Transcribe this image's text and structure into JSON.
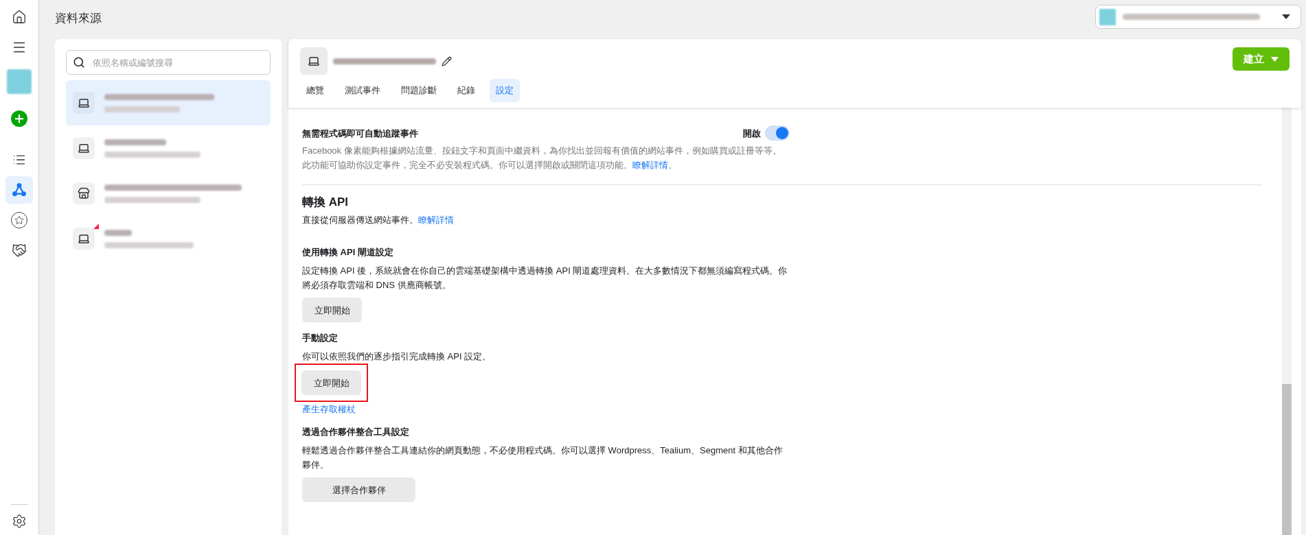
{
  "rail": {
    "items": [
      {
        "kind": "home",
        "selected": false
      },
      {
        "kind": "menu",
        "selected": false
      },
      {
        "kind": "avatar",
        "selected": false
      },
      {
        "kind": "add",
        "selected": false
      },
      {
        "kind": "list",
        "selected": false
      },
      {
        "kind": "network",
        "selected": true
      },
      {
        "kind": "star",
        "selected": false
      },
      {
        "kind": "handshake",
        "selected": false
      }
    ],
    "bottom": [
      {
        "kind": "settings",
        "selected": false
      }
    ]
  },
  "page_title": "資料來源",
  "create_button": {
    "label": "建立"
  },
  "search": {
    "placeholder": "依照名稱或編號搜尋"
  },
  "sources": [
    {
      "kind": "laptop",
      "selected": true,
      "alert": false
    },
    {
      "kind": "laptop",
      "selected": false,
      "alert": false
    },
    {
      "kind": "store",
      "selected": false,
      "alert": false
    },
    {
      "kind": "laptop",
      "selected": false,
      "alert": true
    }
  ],
  "tabs": [
    {
      "label": "總覽",
      "selected": false
    },
    {
      "label": "測試事件",
      "selected": false
    },
    {
      "label": "問題診斷",
      "selected": false
    },
    {
      "label": "紀錄",
      "selected": false
    },
    {
      "label": "設定",
      "selected": true
    }
  ],
  "auto_tracking": {
    "title": "無需程式碼即可自動追蹤事件",
    "toggle_label": "開啟",
    "on": true,
    "description": "Facebook 像素能夠根據網站流量、按鈕文字和頁面中繼資料，為你找出並回報有價值的網站事件，例如購買或註冊等等。此功能可協助你設定事件，完全不必安裝程式碼。你可以選擇開啟或關閉這項功能。",
    "link": "瞭解詳情",
    "suffix": "。"
  },
  "conversions_api": {
    "title": "轉換 API",
    "description": "直接從伺服器傳送網站事件。",
    "link": "瞭解詳情",
    "sections": [
      {
        "title": "使用轉換 API 閘道設定",
        "description": "設定轉換 API 後，系統就會在你自己的雲端基礎架構中透過轉換 API 閘道處理資料。在大多數情況下都無須編寫程式碼。你將必須存取雲端和 DNS 供應商帳號。",
        "button": "立即開始",
        "highlighted": false
      },
      {
        "title": "手動設定",
        "description": "你可以依照我們的逐步指引完成轉換 API 設定。",
        "button": "立即開始",
        "highlighted": true,
        "link": "產生存取權杖"
      },
      {
        "title": "透過合作夥伴整合工具設定",
        "description": "輕鬆透過合作夥伴整合工具連結你的網頁動態，不必使用程式碼。你可以選擇 Wordpress、Tealium、Segment 和其他合作夥伴。",
        "button": "選擇合作夥伴",
        "highlighted": false
      }
    ]
  }
}
